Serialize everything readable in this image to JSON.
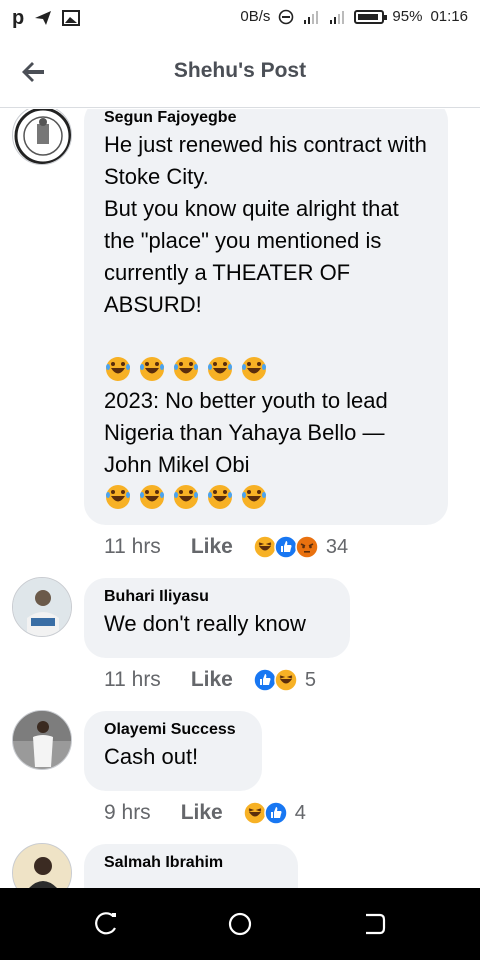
{
  "status_bar": {
    "speed": "0B/s",
    "battery": "95%",
    "time": "01:16"
  },
  "header": {
    "title": "Shehu's Post"
  },
  "comments": [
    {
      "author": "Segun Fajoyegbe",
      "text_part1": "He just renewed his contract with Stoke City.\nBut you know quite alright that the \"place\" you mentioned is currently a THEATER OF ABSURD!",
      "text_part2": "2023: No better youth to lead Nigeria than Yahaya Bello — John Mikel Obi",
      "emoji": "rolling-on-floor-laughing",
      "time": "11 hrs",
      "like_label": "Like",
      "reactions": [
        "haha",
        "like",
        "angry"
      ],
      "reaction_count": "34"
    },
    {
      "author": "Buhari Iliyasu",
      "text": "We don't really know",
      "time": "11 hrs",
      "like_label": "Like",
      "reactions": [
        "like",
        "haha"
      ],
      "reaction_count": "5"
    },
    {
      "author": "Olayemi Success",
      "text": "Cash out!",
      "time": "9 hrs",
      "like_label": "Like",
      "reactions": [
        "haha",
        "like"
      ],
      "reaction_count": "4"
    },
    {
      "author": "Salmah Ibrahim"
    }
  ],
  "colors": {
    "bubble": "#f0f2f5",
    "meta": "#65676b",
    "like_blue": "#1877f2",
    "haha_yellow": "#f7b125",
    "angry_orange": "#e9710f"
  }
}
